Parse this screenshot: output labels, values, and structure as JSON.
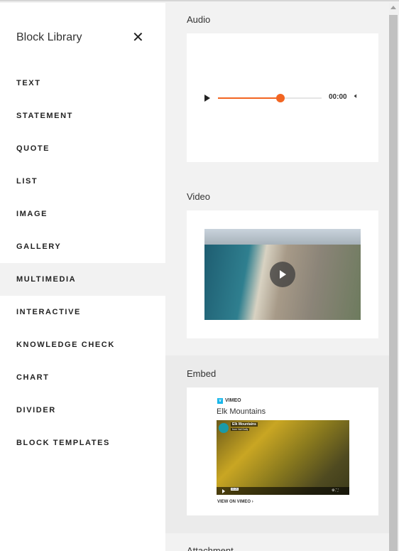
{
  "sidebar": {
    "title": "Block Library",
    "close_icon": "close-icon",
    "items": [
      {
        "label": "TEXT"
      },
      {
        "label": "STATEMENT"
      },
      {
        "label": "QUOTE"
      },
      {
        "label": "LIST"
      },
      {
        "label": "IMAGE"
      },
      {
        "label": "GALLERY"
      },
      {
        "label": "MULTIMEDIA",
        "active": true
      },
      {
        "label": "INTERACTIVE"
      },
      {
        "label": "KNOWLEDGE CHECK"
      },
      {
        "label": "CHART"
      },
      {
        "label": "DIVIDER"
      },
      {
        "label": "BLOCK TEMPLATES"
      }
    ]
  },
  "main": {
    "audio": {
      "title": "Audio",
      "time": "00:00",
      "progress": 0.6,
      "accent": "#f26522"
    },
    "video": {
      "title": "Video"
    },
    "embed": {
      "title": "Embed",
      "provider": "VIMEO",
      "video_title": "Elk Mountains",
      "overlay_title": "Elk Mountains",
      "overlay_sub": "from Vail Daily",
      "time": "03:25",
      "link": "VIEW ON VIMEO",
      "brand": "#1ab7ea"
    },
    "attachment": {
      "title": "Attachment"
    }
  }
}
